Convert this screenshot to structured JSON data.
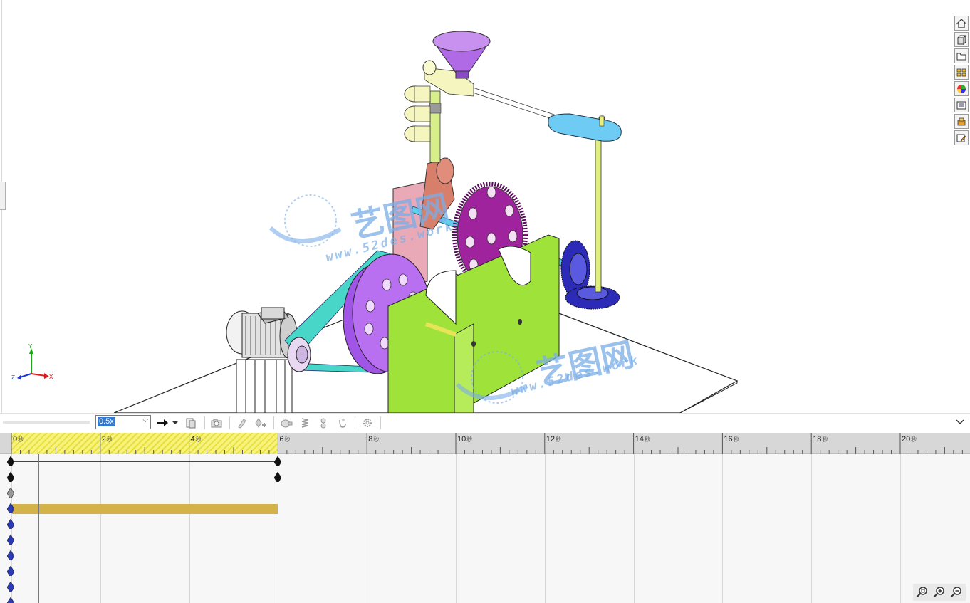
{
  "watermark": {
    "brand": "艺图网",
    "url": "www.52des.work"
  },
  "triad": {
    "x": "X",
    "y": "Y",
    "z": "Z"
  },
  "toolbar": {
    "zoom_value": "0.5x",
    "buttons": [
      "play-arrow-icon",
      "calculate-icon",
      "animation-wizard-icon",
      "autokey-icon",
      "add-key-icon",
      "motor-icon",
      "spring-icon",
      "contact-icon",
      "gravity-icon",
      "results-icon",
      "settings-icon"
    ]
  },
  "timeline": {
    "ticks": [
      {
        "label": "0 秒"
      },
      {
        "label": "2 秒"
      },
      {
        "label": "4 秒"
      },
      {
        "label": "6 秒"
      },
      {
        "label": "8 秒"
      },
      {
        "label": "10 秒"
      },
      {
        "label": "12 秒"
      },
      {
        "label": "14 秒"
      },
      {
        "label": "16 秒"
      },
      {
        "label": "18 秒"
      },
      {
        "label": "20 秒"
      }
    ],
    "duration_s": 6,
    "current_time_s": 0.3,
    "unit_icon": "秒"
  },
  "colors": {
    "base_plate": "#ffffff",
    "frame_green": "#9ee23a",
    "gear_purple": "#9a1d9a",
    "pulley_violet": "#b36af0",
    "belt_cyan": "#48d6c8",
    "cam_blue": "#6ecbf4",
    "funnel_violet": "#b06ae6",
    "motor_grey": "#d0d0d0",
    "timeline_bar": "#d4b24a"
  }
}
